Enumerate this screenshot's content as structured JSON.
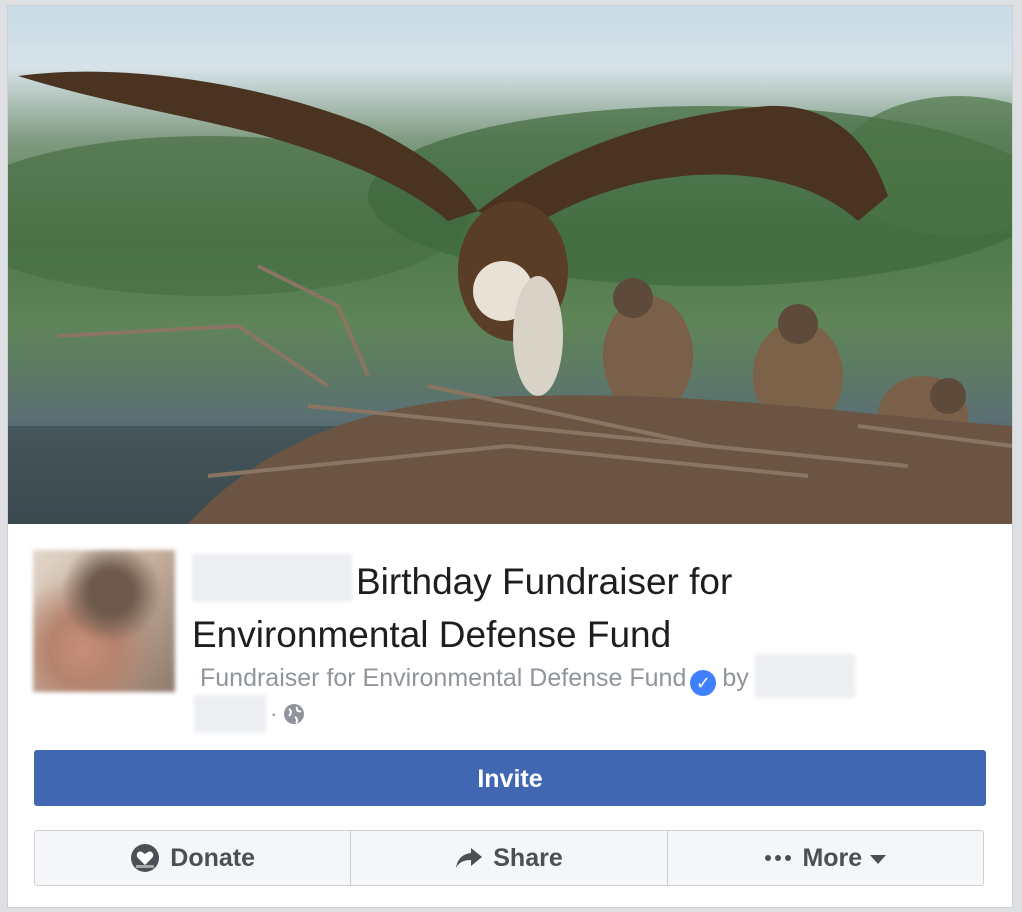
{
  "fundraiser": {
    "cover_alt": "Osprey with chicks on nest",
    "title": "Birthday Fundraiser for Environmental Defense Fund",
    "subtitle_prefix": "Fundraiser for Environmental Defense Fund",
    "by_label": "by",
    "separator": "·"
  },
  "buttons": {
    "invite": "Invite",
    "donate": "Donate",
    "share": "Share",
    "more": "More"
  },
  "icons": {
    "verified": "verified-check-icon",
    "globe": "globe-icon",
    "donate": "donate-heart-icon",
    "share": "share-arrow-icon",
    "more": "more-dots-icon",
    "more_caret": "caret-down-icon"
  },
  "colors": {
    "primary": "#4267b2",
    "verified": "#4080ff",
    "meta_text": "#90949c",
    "action_text": "#4b4f56"
  }
}
